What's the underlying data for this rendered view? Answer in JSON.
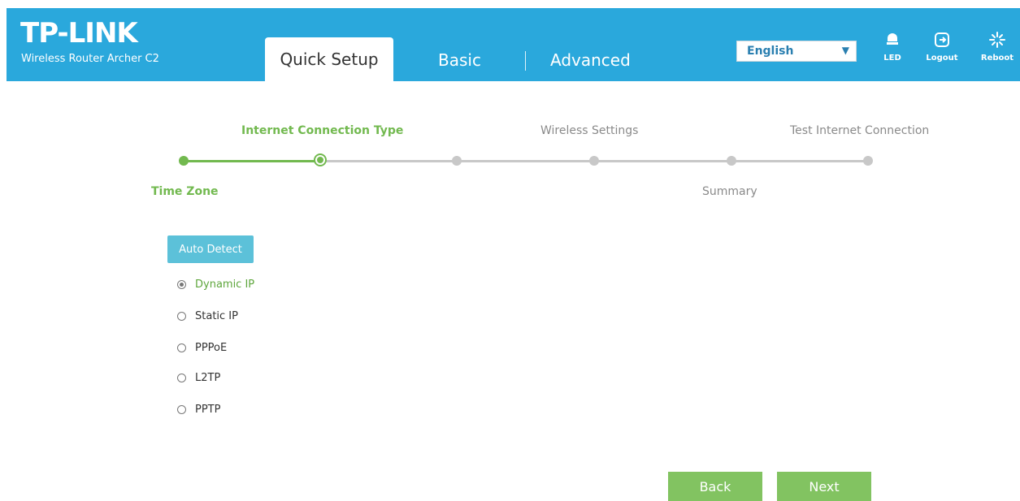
{
  "header": {
    "brand": "TP-LINK",
    "model": "Wireless Router Archer C2",
    "tabs": [
      {
        "label": "Quick Setup",
        "active": true
      },
      {
        "label": "Basic",
        "active": false
      },
      {
        "label": "Advanced",
        "active": false
      }
    ],
    "language": "English",
    "icons": [
      {
        "name": "led-icon",
        "label": "LED"
      },
      {
        "name": "logout-icon",
        "label": "Logout"
      },
      {
        "name": "reboot-icon",
        "label": "Reboot"
      }
    ]
  },
  "wizard": {
    "steps_top": [
      "Internet Connection Type",
      "Wireless Settings",
      "Test Internet Connection"
    ],
    "steps_bottom": [
      "Time Zone",
      "Summary"
    ]
  },
  "content": {
    "auto_detect": "Auto Detect",
    "options": [
      "Dynamic IP",
      "Static IP",
      "PPPoE",
      "L2TP",
      "PPTP"
    ],
    "selected": "Dynamic IP"
  },
  "footer": {
    "back": "Back",
    "next": "Next"
  },
  "colors": {
    "header": "#2aa8dc",
    "green": "#72b94f",
    "button_green": "#82c361",
    "auto_detect": "#5cc1d9"
  }
}
